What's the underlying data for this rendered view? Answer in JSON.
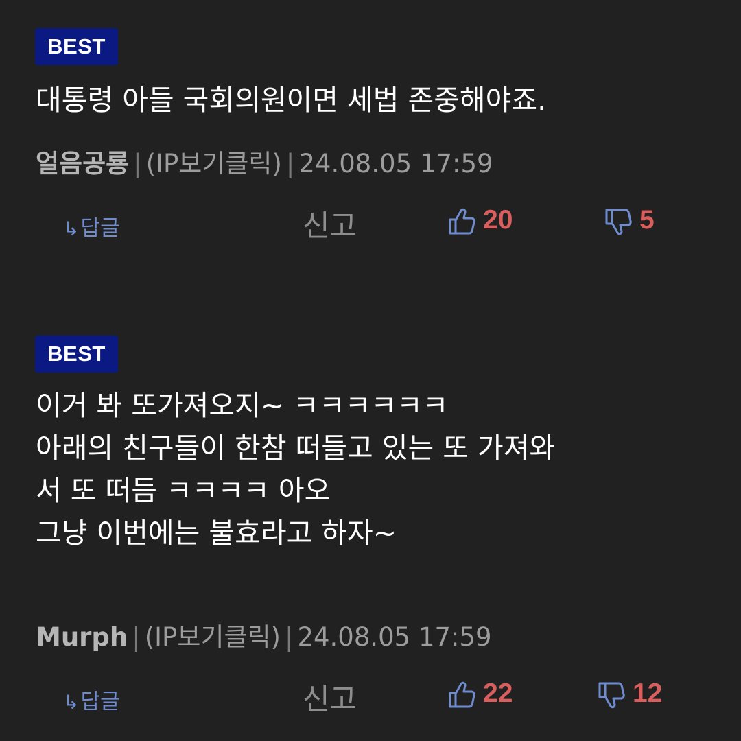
{
  "comments": [
    {
      "badge": "BEST",
      "lines": [
        "대통령 아들 국회의원이면 세법 존중해야죠."
      ],
      "author": "얼음공룡",
      "ip_label": "(IP보기클릭)",
      "separator": "|",
      "timestamp": "24.08.05 17:59",
      "reply_icon": "↳",
      "reply_label": "답글",
      "report_label": "신고",
      "likes": "20",
      "dislikes": "5"
    },
    {
      "badge": "BEST",
      "lines": [
        "이거 봐 또가져오지~ ㅋㅋㅋㅋㅋㅋ",
        "아래의 친구들이 한참 떠들고 있는 또 가져와",
        "서 또 떠듬 ㅋㅋㅋㅋ 아오",
        "그냥 이번에는 불효라고 하자~"
      ],
      "author": "Murph",
      "ip_label": "(IP보기클릭)",
      "separator": "|",
      "timestamp": "24.08.05 17:59",
      "reply_icon": "↳",
      "reply_label": "답글",
      "report_label": "신고",
      "likes": "22",
      "dislikes": "12"
    }
  ],
  "colors": {
    "background": "#212121",
    "badge": "#0b1a82",
    "reply": "#6f8ccf",
    "vote_icon": "#6f8ccf",
    "vote_count": "#d95f5f",
    "meta": "#9c9c9c"
  },
  "icons": {
    "like": "thumbs-up-icon",
    "dislike": "thumbs-down-icon",
    "reply": "reply-arrow-icon"
  }
}
